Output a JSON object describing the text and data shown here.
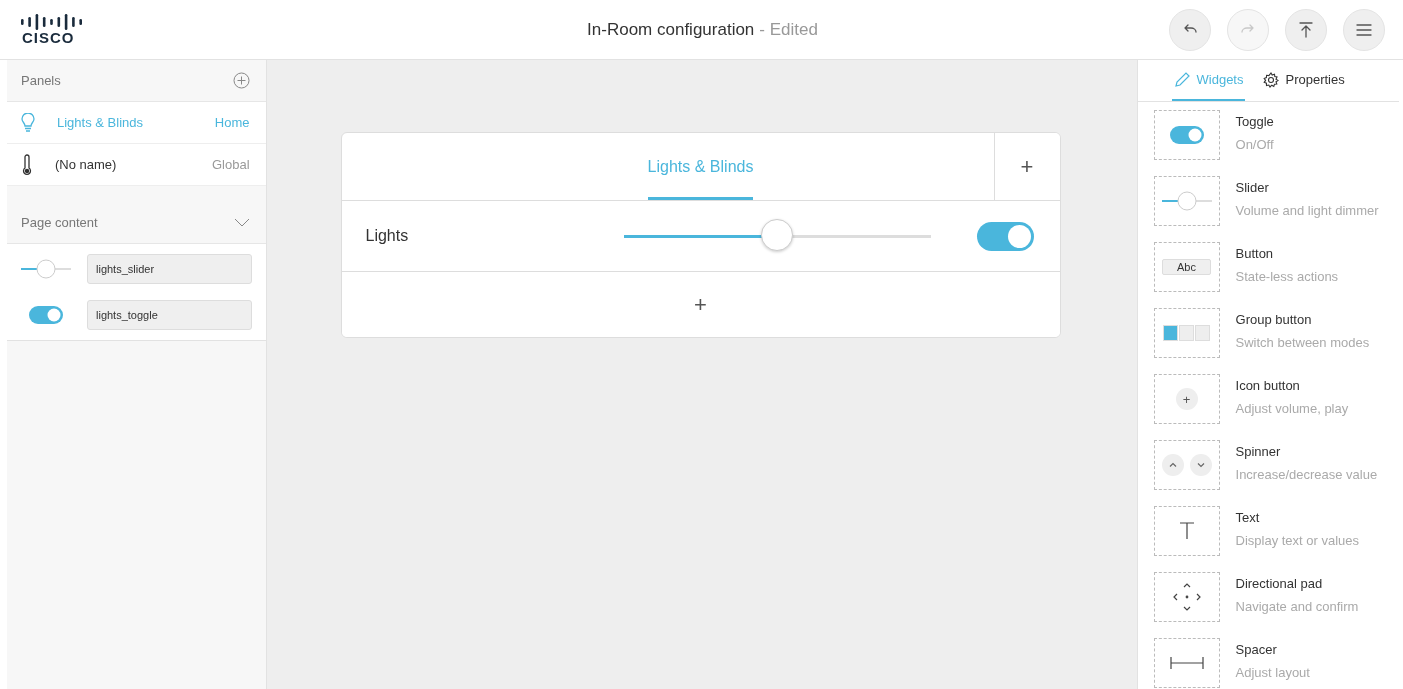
{
  "header": {
    "logo": "CISCO",
    "title": "In-Room configuration",
    "status": "- Edited",
    "buttons": [
      {
        "kind": "undo",
        "disabled": false
      },
      {
        "kind": "redo",
        "disabled": true
      },
      {
        "kind": "upload",
        "disabled": false
      },
      {
        "kind": "menu",
        "disabled": false
      }
    ]
  },
  "panels": {
    "title": "Panels",
    "items": [
      {
        "kind": "bulb",
        "name": "Lights & Blinds",
        "scope": "Home",
        "selected": true
      },
      {
        "kind": "thermometer",
        "name": "(No name)",
        "scope": "Global",
        "selected": false
      }
    ]
  },
  "page_content": {
    "title": "Page content",
    "expanded": true,
    "items": [
      {
        "kind": "slider",
        "value": "lights_slider"
      },
      {
        "kind": "toggle",
        "value": "lights_toggle"
      }
    ]
  },
  "canvas": {
    "tabs": [
      {
        "label": "Lights & Blinds",
        "selected": true
      }
    ],
    "add_tab": "+",
    "rows": [
      {
        "label": "Lights",
        "slider": {
          "level": 0.5
        },
        "toggle": {
          "on": true
        }
      }
    ],
    "add_row": "+"
  },
  "sidebar_tabs": [
    {
      "label": "Widgets",
      "kind": "widgets",
      "selected": true
    },
    {
      "label": "Properties",
      "kind": "properties",
      "selected": false
    }
  ],
  "widgets": [
    {
      "kind": "toggle",
      "name": "Toggle",
      "description": "On/Off"
    },
    {
      "kind": "slider",
      "name": "Slider",
      "description": "Volume and light dimmer"
    },
    {
      "kind": "button",
      "name": "Button",
      "description": "State-less actions",
      "preview_text": "Abc"
    },
    {
      "kind": "group",
      "name": "Group button",
      "description": "Switch between modes"
    },
    {
      "kind": "iconbutton",
      "name": "Icon button",
      "description": "Adjust volume, play",
      "preview_text": "+"
    },
    {
      "kind": "spinner",
      "name": "Spinner",
      "description": "Increase/decrease value"
    },
    {
      "kind": "text",
      "name": "Text",
      "description": "Display text or values"
    },
    {
      "kind": "dpad",
      "name": "Directional pad",
      "description": "Navigate and confirm"
    },
    {
      "kind": "spacer",
      "name": "Spacer",
      "description": "Adjust layout"
    }
  ]
}
